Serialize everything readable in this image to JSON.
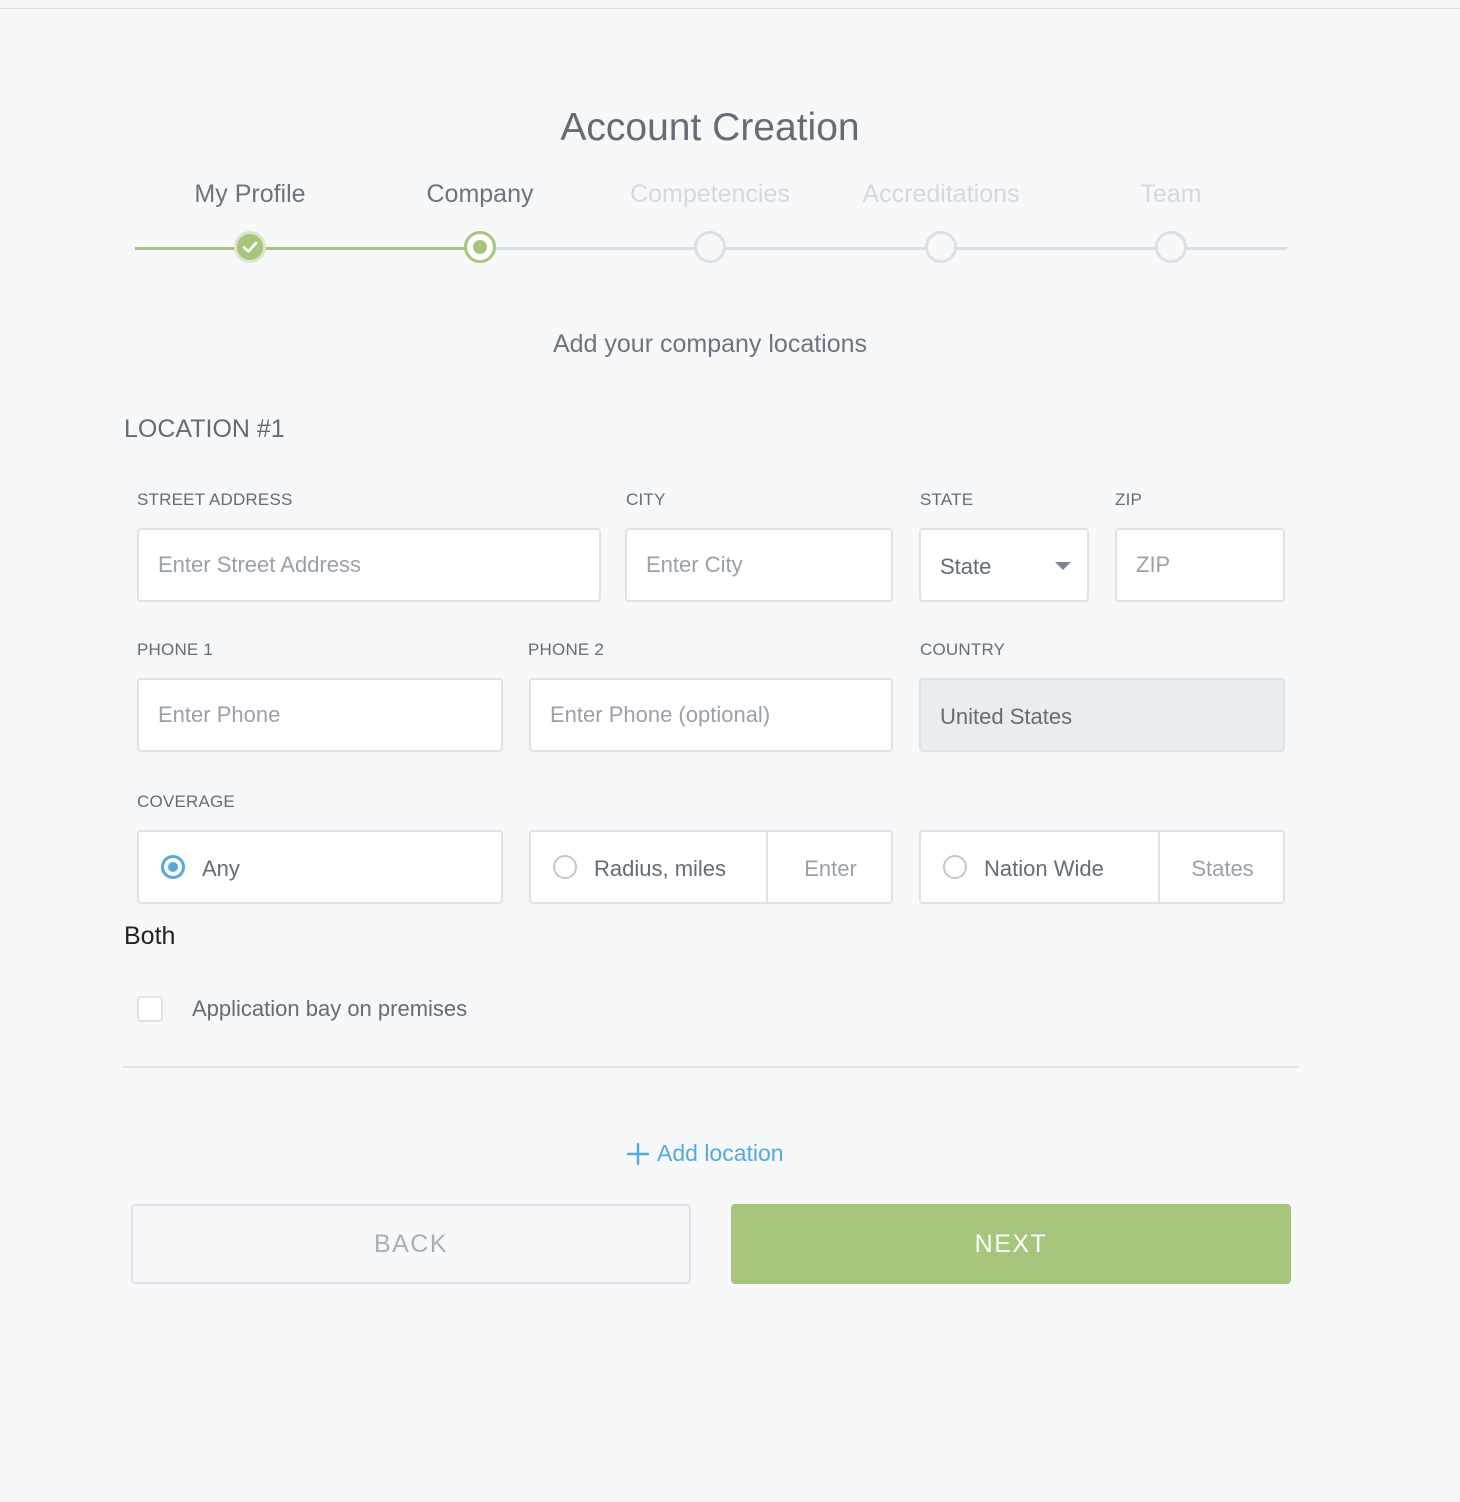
{
  "title": "Account Creation",
  "steps": [
    {
      "label": "My Profile",
      "status": "completed"
    },
    {
      "label": "Company",
      "status": "current"
    },
    {
      "label": "Competencies",
      "status": "upcoming"
    },
    {
      "label": "Accreditations",
      "status": "upcoming"
    },
    {
      "label": "Team",
      "status": "upcoming"
    }
  ],
  "subtitle": "Add your company locations",
  "location": {
    "heading": "LOCATION #1",
    "street": {
      "label": "STREET ADDRESS",
      "placeholder": "Enter Street Address",
      "value": ""
    },
    "city": {
      "label": "CITY",
      "placeholder": "Enter City",
      "value": ""
    },
    "state": {
      "label": "STATE",
      "value": "State"
    },
    "zip": {
      "label": "ZIP",
      "placeholder": "ZIP",
      "value": ""
    },
    "phone1": {
      "label": "PHONE 1",
      "placeholder": "Enter Phone",
      "value": ""
    },
    "phone2": {
      "label": "PHONE 2",
      "placeholder": "Enter Phone (optional)",
      "value": ""
    },
    "country": {
      "label": "COUNTRY",
      "value": "United States"
    },
    "coverage": {
      "label": "COVERAGE",
      "options": [
        {
          "label": "Any",
          "selected": true
        },
        {
          "label": "Radius, miles",
          "selected": false,
          "aux_placeholder": "Enter"
        },
        {
          "label": "Nation Wide",
          "selected": false,
          "aux_placeholder": "States"
        }
      ]
    },
    "both_text": "Both",
    "application_bay": {
      "label": "Application bay on premises",
      "checked": false
    }
  },
  "add_location": "Add location",
  "buttons": {
    "back": "BACK",
    "next": "NEXT"
  },
  "colors": {
    "accent_green": "#a7c57d",
    "accent_blue": "#55a9e0",
    "text": "#646c77",
    "background": "#f7f8fa"
  }
}
